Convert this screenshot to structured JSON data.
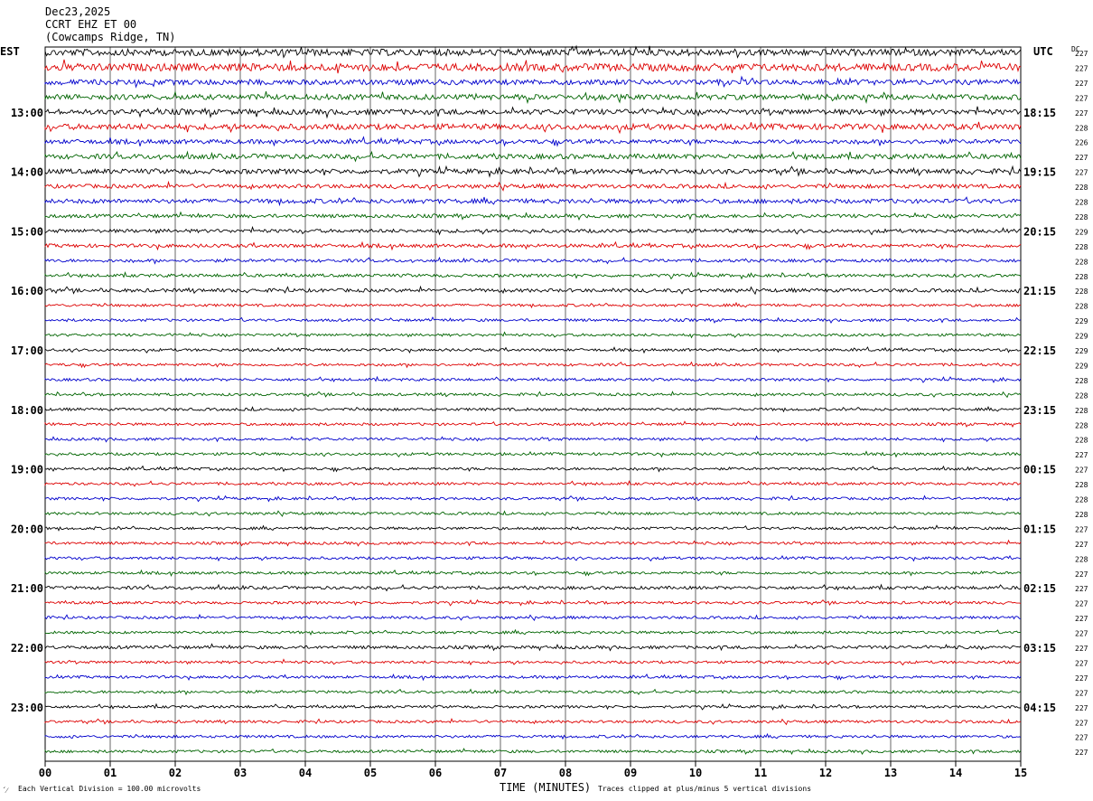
{
  "header": {
    "date": "Dec23,2025",
    "channel": "CCRT EHZ ET 00",
    "location": "(Cowcamps Ridge, TN)"
  },
  "left_axis_title": "EST",
  "right_axis_title": "UTC",
  "dc_title": "DC",
  "footer": {
    "scale_note": "Each Vertical Division =  100.00 microvolts",
    "clip_note": "Traces clipped at plus/minus 5 vertical divisions",
    "corner_mark": "´⁄"
  },
  "colors": {
    "trace_cycle": [
      "#000000",
      "#dd0000",
      "#0000cc",
      "#006400"
    ],
    "grid": "#000000"
  },
  "chart_data": {
    "type": "line",
    "title": "",
    "xlabel": "TIME (MINUTES)",
    "ylabel": "",
    "xlim": [
      0,
      15
    ],
    "x_ticks": [
      "00",
      "01",
      "02",
      "03",
      "04",
      "05",
      "06",
      "07",
      "08",
      "09",
      "10",
      "11",
      "12",
      "13",
      "14",
      "15"
    ],
    "grid": true,
    "rows_per_hour": 4,
    "n_rows": 48,
    "left_hour_labels": [
      "13:00",
      "14:00",
      "15:00",
      "16:00",
      "17:00",
      "18:00",
      "19:00",
      "20:00",
      "21:00",
      "22:00",
      "23:00"
    ],
    "right_hour_labels": [
      "18:15",
      "19:15",
      "20:15",
      "21:15",
      "22:15",
      "23:15",
      "00:15",
      "01:15",
      "02:15",
      "03:15",
      "04:15"
    ],
    "dc_offsets": [
      227,
      227,
      227,
      227,
      227,
      228,
      226,
      227,
      227,
      228,
      228,
      228,
      229,
      228,
      228,
      228,
      228,
      228,
      229,
      229,
      229,
      229,
      228,
      228,
      228,
      228,
      228,
      227,
      227,
      228,
      228,
      228,
      227,
      227,
      228,
      227,
      227,
      227,
      227,
      227,
      227,
      227,
      227,
      227,
      227,
      227,
      227,
      227
    ],
    "row_amplitude": [
      1.5,
      1.7,
      1.2,
      1.2,
      1.2,
      1.3,
      1.0,
      1.1,
      1.1,
      0.9,
      1.0,
      0.8,
      0.8,
      0.8,
      0.7,
      0.7,
      0.8,
      0.6,
      0.6,
      0.6,
      0.6,
      0.6,
      0.6,
      0.6,
      0.6,
      0.6,
      0.6,
      0.6,
      0.6,
      0.6,
      0.6,
      0.6,
      0.6,
      0.6,
      0.6,
      0.6,
      0.7,
      0.6,
      0.6,
      0.6,
      0.7,
      0.6,
      0.6,
      0.6,
      0.6,
      0.6,
      0.6,
      0.6
    ],
    "series_note_units": "microvolts"
  }
}
